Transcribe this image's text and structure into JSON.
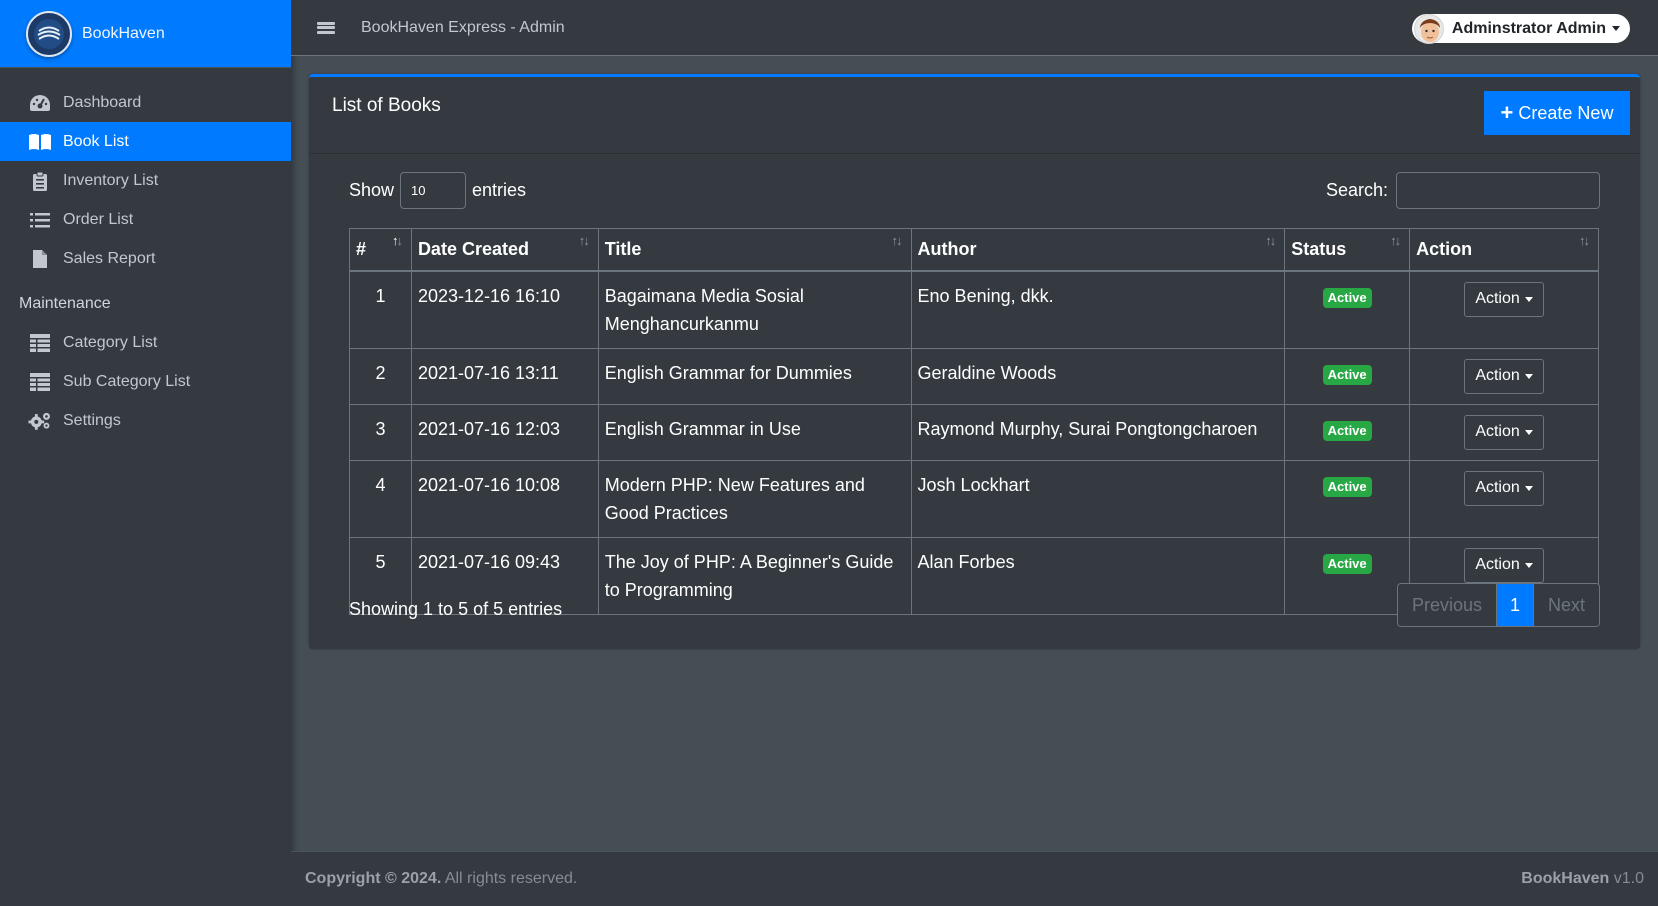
{
  "brand": {
    "name": "BookHaven"
  },
  "sidebar": {
    "items": [
      {
        "label": "Dashboard",
        "icon": "dashboard-icon"
      },
      {
        "label": "Book List",
        "icon": "book-open-icon",
        "active": true
      },
      {
        "label": "Inventory List",
        "icon": "clipboard-icon"
      },
      {
        "label": "Order List",
        "icon": "list-icon"
      },
      {
        "label": "Sales Report",
        "icon": "file-icon"
      }
    ],
    "section_header": "Maintenance",
    "maintenance_items": [
      {
        "label": "Category List",
        "icon": "table-icon"
      },
      {
        "label": "Sub Category List",
        "icon": "table-icon"
      },
      {
        "label": "Settings",
        "icon": "cogs-icon"
      }
    ]
  },
  "topbar": {
    "title": "BookHaven Express - Admin",
    "user_name": "Adminstrator Admin"
  },
  "card": {
    "title": "List of Books",
    "create_label": "Create New"
  },
  "datatable": {
    "show_label": "Show",
    "entries_label": "entries",
    "length_value": "10",
    "search_label": "Search:",
    "search_value": "",
    "columns": [
      "#",
      "Date Created",
      "Title",
      "Author",
      "Status",
      "Action"
    ],
    "rows": [
      {
        "num": "1",
        "date": "2023-12-16 16:10",
        "title": "Bagaimana Media Sosial Menghancurkanmu",
        "author": "Eno Bening, dkk.",
        "status": "Active",
        "action": "Action"
      },
      {
        "num": "2",
        "date": "2021-07-16 13:11",
        "title": "English Grammar for Dummies",
        "author": "Geraldine Woods",
        "status": "Active",
        "action": "Action"
      },
      {
        "num": "3",
        "date": "2021-07-16 12:03",
        "title": "English Grammar in Use",
        "author": "Raymond Murphy, Surai Pongtongcharoen",
        "status": "Active",
        "action": "Action"
      },
      {
        "num": "4",
        "date": "2021-07-16 10:08",
        "title": "Modern PHP: New Features and Good Practices",
        "author": "Josh Lockhart",
        "status": "Active",
        "action": "Action"
      },
      {
        "num": "5",
        "date": "2021-07-16 09:43",
        "title": "The Joy of PHP: A Beginner's Guide to Programming",
        "author": "Alan Forbes",
        "status": "Active",
        "action": "Action"
      }
    ],
    "info": "Showing 1 to 5 of 5 entries",
    "pagination": {
      "previous": "Previous",
      "current": "1",
      "next": "Next"
    }
  },
  "footer": {
    "copyright_bold": "Copyright © 2024.",
    "copyright_rest": "All rights reserved.",
    "app_name": "BookHaven",
    "version": "v1.0"
  },
  "colors": {
    "accent": "#007bff",
    "sidebar_bg": "#343a40",
    "content_bg": "#454d55",
    "status_active": "#28a745"
  }
}
